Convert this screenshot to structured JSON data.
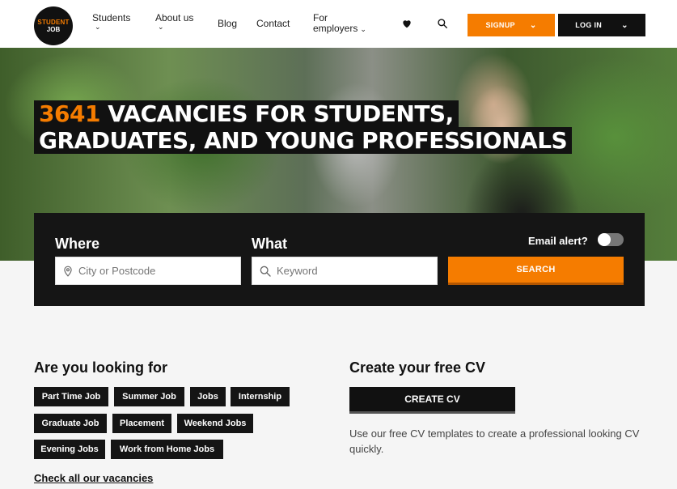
{
  "header": {
    "logo_line1": "STUDENT",
    "logo_line2": "JOB",
    "nav": [
      {
        "label": "Students"
      },
      {
        "label": "About us"
      },
      {
        "label": "Blog"
      },
      {
        "label": "Contact"
      },
      {
        "label": "For employers"
      }
    ],
    "signup_label": "SIGNUP",
    "login_label": "LOG IN",
    "icons": {
      "favorites": "heart-icon",
      "search": "search-icon"
    }
  },
  "hero": {
    "vacancy_count": "3641",
    "title_line1": "VACANCIES FOR STUDENTS,",
    "title_line2": "GRADUATES, AND YOUNG PROFESSIONALS"
  },
  "search": {
    "where_label": "Where",
    "what_label": "What",
    "where_placeholder": "City or Postcode",
    "what_placeholder": "Keyword",
    "email_alert_label": "Email alert?",
    "email_alert_on": false,
    "search_button": "SEARCH"
  },
  "looking_for": {
    "title": "Are you looking for",
    "tags": [
      "Part Time Job",
      "Summer Job",
      "Jobs",
      "Internship",
      "Graduate Job",
      "Placement",
      "Weekend Jobs",
      "Evening Jobs",
      "Work from Home Jobs"
    ],
    "check_all": "Check all our vacancies"
  },
  "cv": {
    "title": "Create your free CV",
    "button": "CREATE CV",
    "description": "Use our free CV templates to create a professional looking CV quickly."
  },
  "colors": {
    "accent": "#f57c00",
    "dark": "#151515",
    "background": "#f5f5f5"
  }
}
